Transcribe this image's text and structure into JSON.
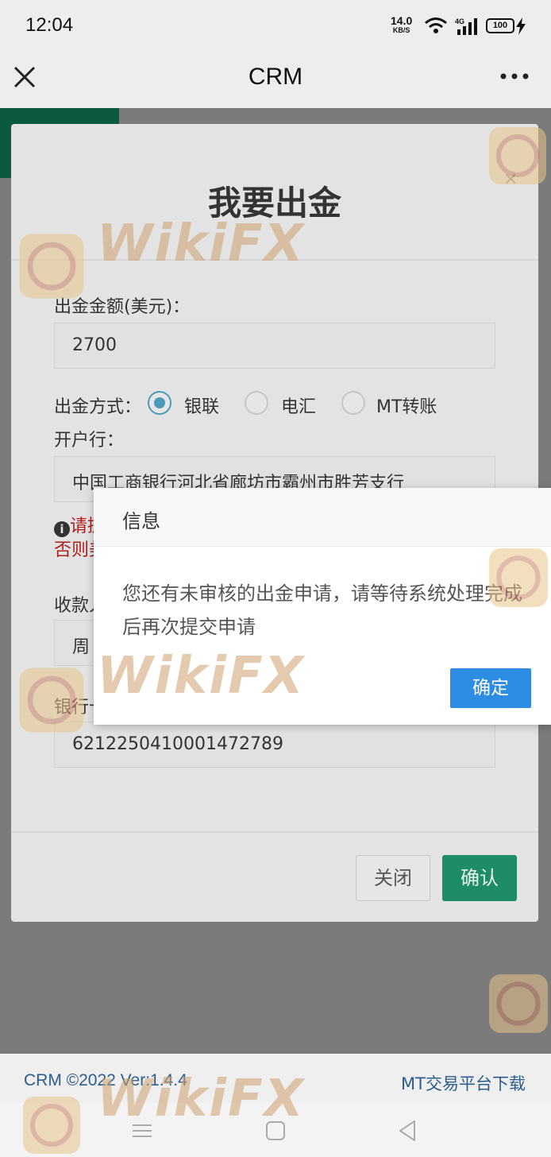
{
  "status_bar": {
    "time": "12:04",
    "net_speed": "14.0",
    "net_speed_unit": "KB/S",
    "network": "4G",
    "battery": "100"
  },
  "header": {
    "title": "CRM",
    "close_icon": "close-icon",
    "more_icon": "more-icon"
  },
  "withdraw_modal": {
    "title": "我要出金",
    "amount_label": "出金金额(美元)：",
    "amount_value": "2700",
    "method_label": "出金方式：",
    "methods": [
      {
        "label": "银联",
        "selected": true
      },
      {
        "label": "电汇",
        "selected": false
      },
      {
        "label": "MT转账",
        "selected": false
      }
    ],
    "bank_label": "开户行：",
    "bank_value": "中国工商银行河北省廊坊市霸州市胜芳支行",
    "warning_line1": "请提",
    "warning_line2": "否则美",
    "payee_label": "收款人",
    "payee_value": "周",
    "card_label": "银行卡",
    "card_value": "6212250410001472789",
    "close_button": "关闭",
    "confirm_button": "确认"
  },
  "info_dialog": {
    "title": "信息",
    "message": "您还有未审核的出金申请，请等待系统处理完成后再次提交申请",
    "ok_button": "确定"
  },
  "footer": {
    "copyright": "CRM ©2022 Ver:1.4.4",
    "download_link": "MT交易平台下载"
  },
  "watermark": {
    "text": "WikiFX"
  },
  "colors": {
    "primary_green": "#1e8d66",
    "dialog_blue": "#2d8de3",
    "warning_red": "#b01d1d",
    "link_blue": "#2d5d8c"
  }
}
